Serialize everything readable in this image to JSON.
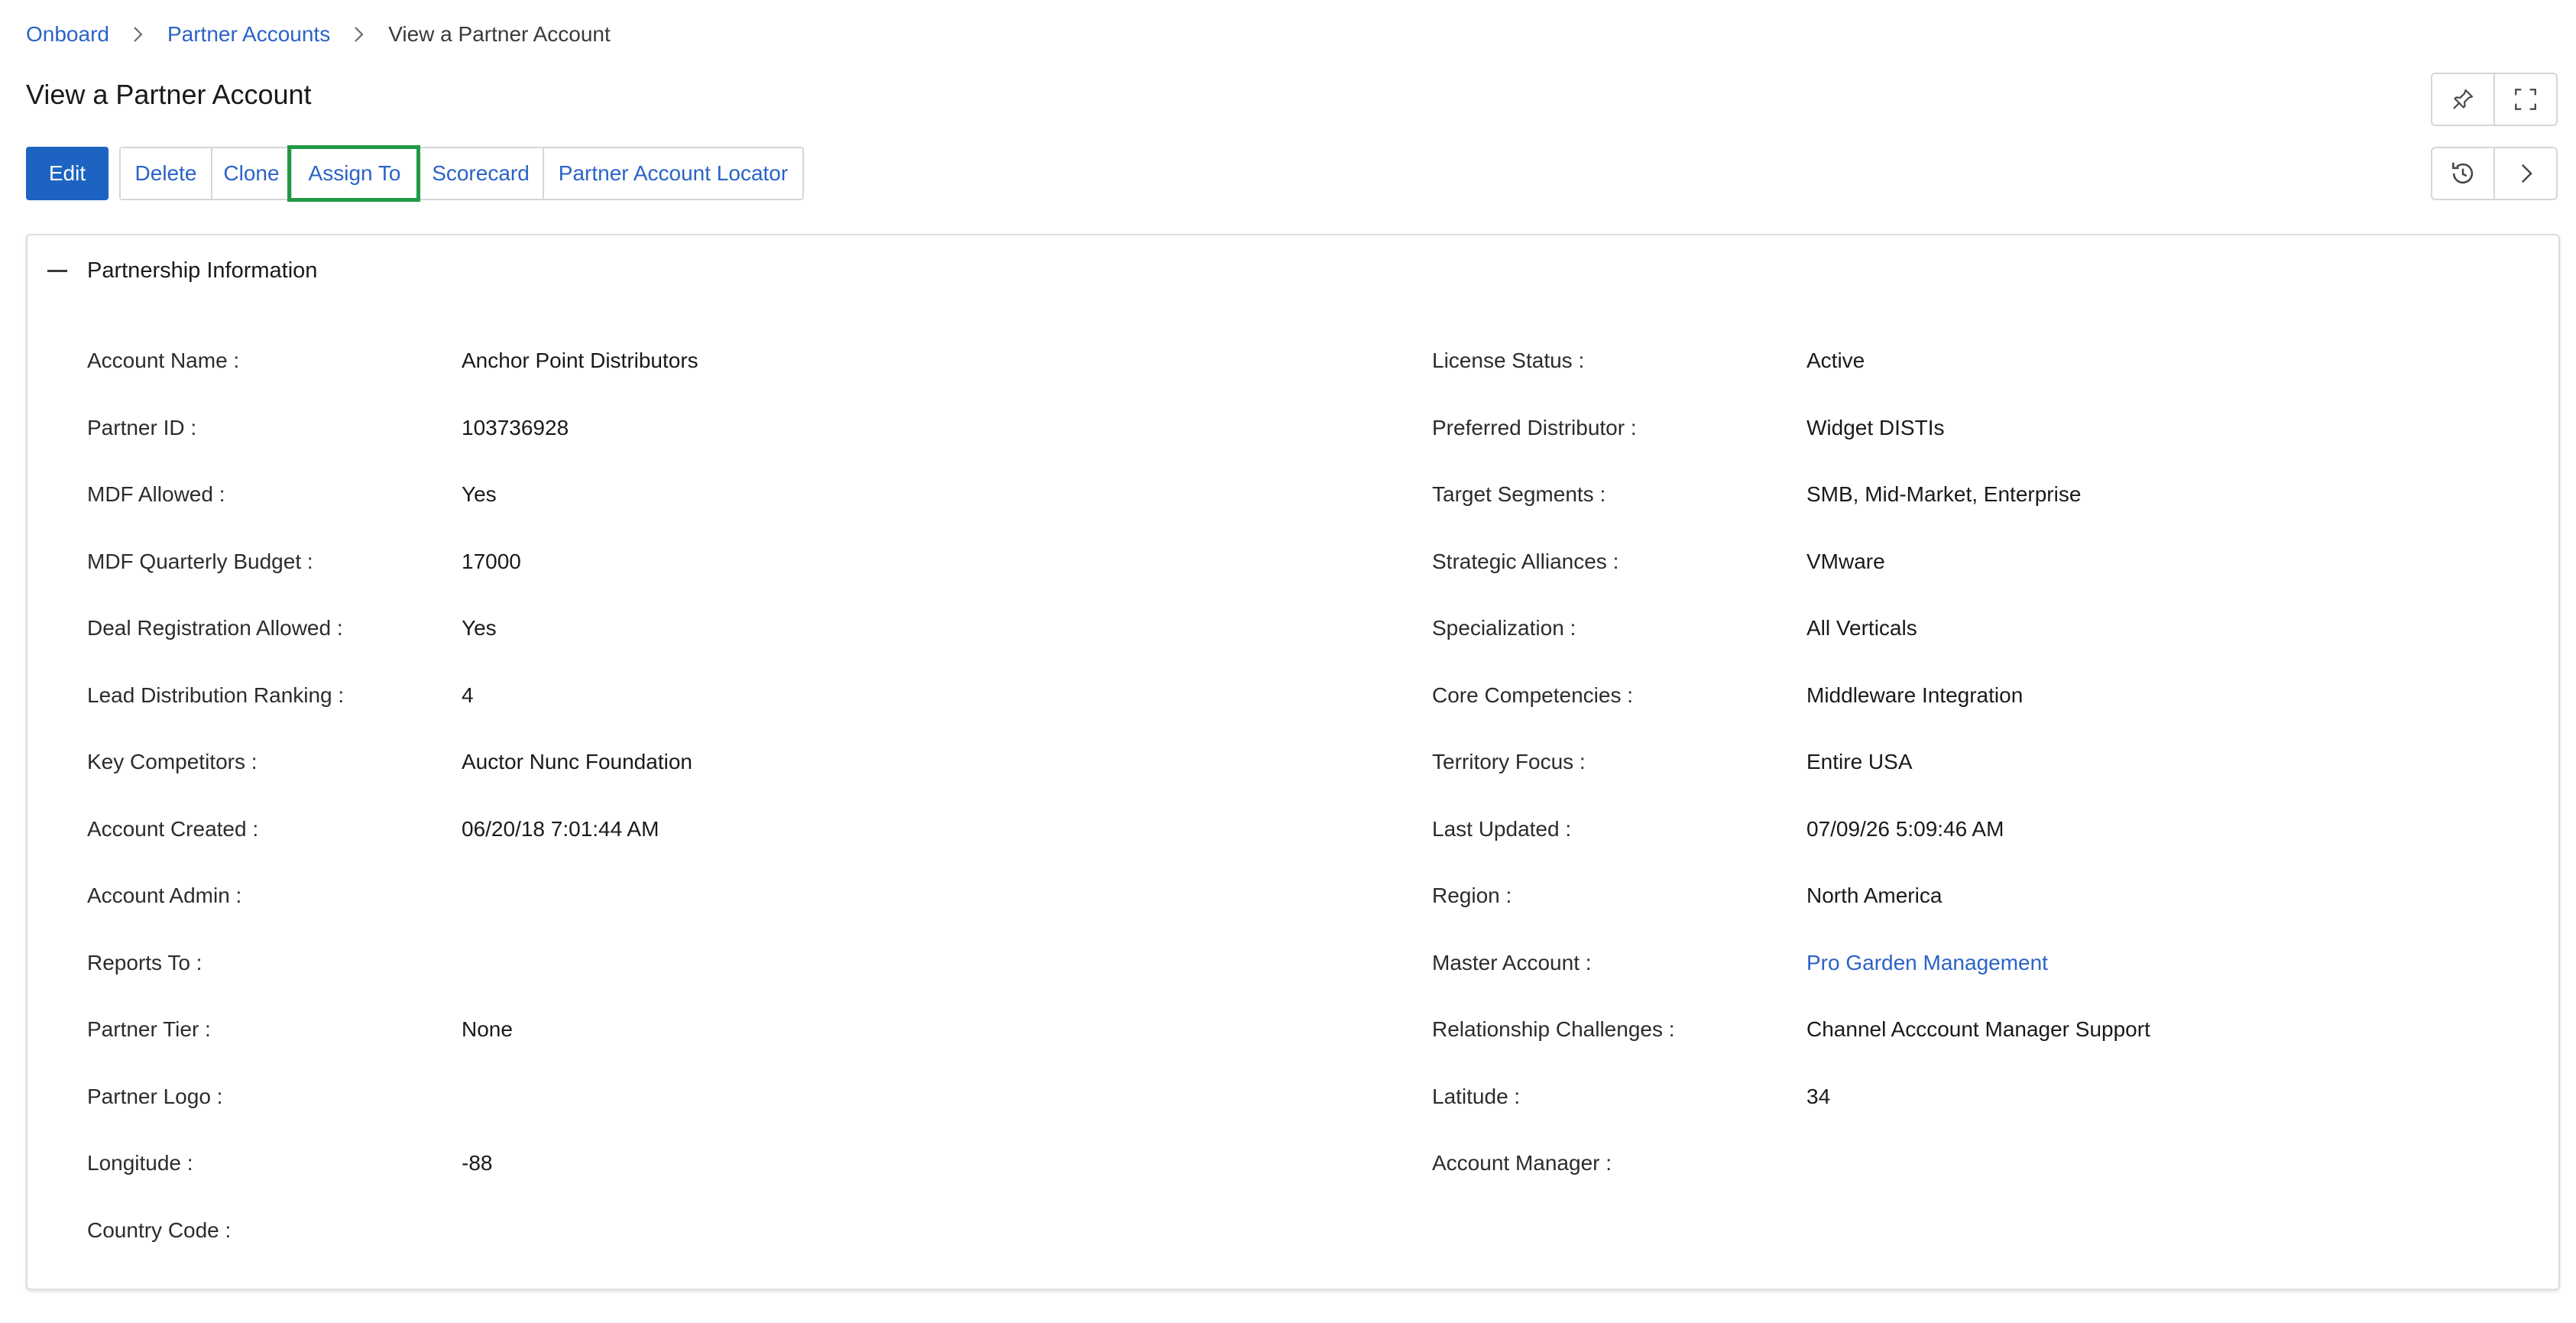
{
  "breadcrumb": {
    "items": [
      "Onboard",
      "Partner Accounts"
    ],
    "current": "View a Partner Account"
  },
  "page": {
    "title": "View a Partner Account"
  },
  "toolbar": {
    "edit_label": "Edit",
    "buttons": [
      "Delete",
      "Clone",
      "Assign To",
      "Scorecard",
      "Partner Account Locator"
    ],
    "highlighted_button": "Assign To"
  },
  "icons": {
    "top": [
      "pin-icon",
      "fullscreen-icon"
    ],
    "actions": [
      "history-icon",
      "chevron-right-icon"
    ]
  },
  "section": {
    "title": "Partnership Information",
    "left_fields": [
      {
        "label": "Account Name :",
        "value": "Anchor Point Distributors"
      },
      {
        "label": "Partner ID :",
        "value": "103736928"
      },
      {
        "label": "MDF Allowed :",
        "value": "Yes"
      },
      {
        "label": "MDF Quarterly Budget :",
        "value": "17000"
      },
      {
        "label": "Deal Registration Allowed :",
        "value": "Yes"
      },
      {
        "label": "Lead Distribution Ranking :",
        "value": "4"
      },
      {
        "label": "Key Competitors :",
        "value": "Auctor Nunc Foundation"
      },
      {
        "label": "Account Created :",
        "value": "06/20/18 7:01:44 AM"
      },
      {
        "label": "Account Admin :",
        "value": ""
      },
      {
        "label": "Reports To :",
        "value": ""
      },
      {
        "label": "Partner Tier :",
        "value": "None"
      },
      {
        "label": "Partner Logo :",
        "value": ""
      },
      {
        "label": "Longitude :",
        "value": "-88"
      },
      {
        "label": "Country Code :",
        "value": ""
      }
    ],
    "right_fields": [
      {
        "label": "License Status :",
        "value": "Active"
      },
      {
        "label": "Preferred Distributor :",
        "value": "Widget DISTIs"
      },
      {
        "label": "Target Segments :",
        "value": "SMB, Mid-Market, Enterprise"
      },
      {
        "label": "Strategic Alliances :",
        "value": "VMware"
      },
      {
        "label": "Specialization :",
        "value": "All Verticals"
      },
      {
        "label": "Core Competencies :",
        "value": "Middleware Integration"
      },
      {
        "label": "Territory Focus :",
        "value": "Entire USA"
      },
      {
        "label": "Last Updated :",
        "value": "07/09/26 5:09:46 AM"
      },
      {
        "label": "Region :",
        "value": "North America"
      },
      {
        "label": "Master Account :",
        "value": "Pro Garden Management"
      },
      {
        "label": "Relationship Challenges :",
        "value": "Channel Acccount Manager Support"
      },
      {
        "label": "Latitude :",
        "value": "34"
      },
      {
        "label": "Account Manager :",
        "value": ""
      }
    ]
  },
  "colors": {
    "primary": "#1d64c2",
    "link": "#2b63c6",
    "highlight": "#1f9a45",
    "border": "#d4d6da"
  }
}
